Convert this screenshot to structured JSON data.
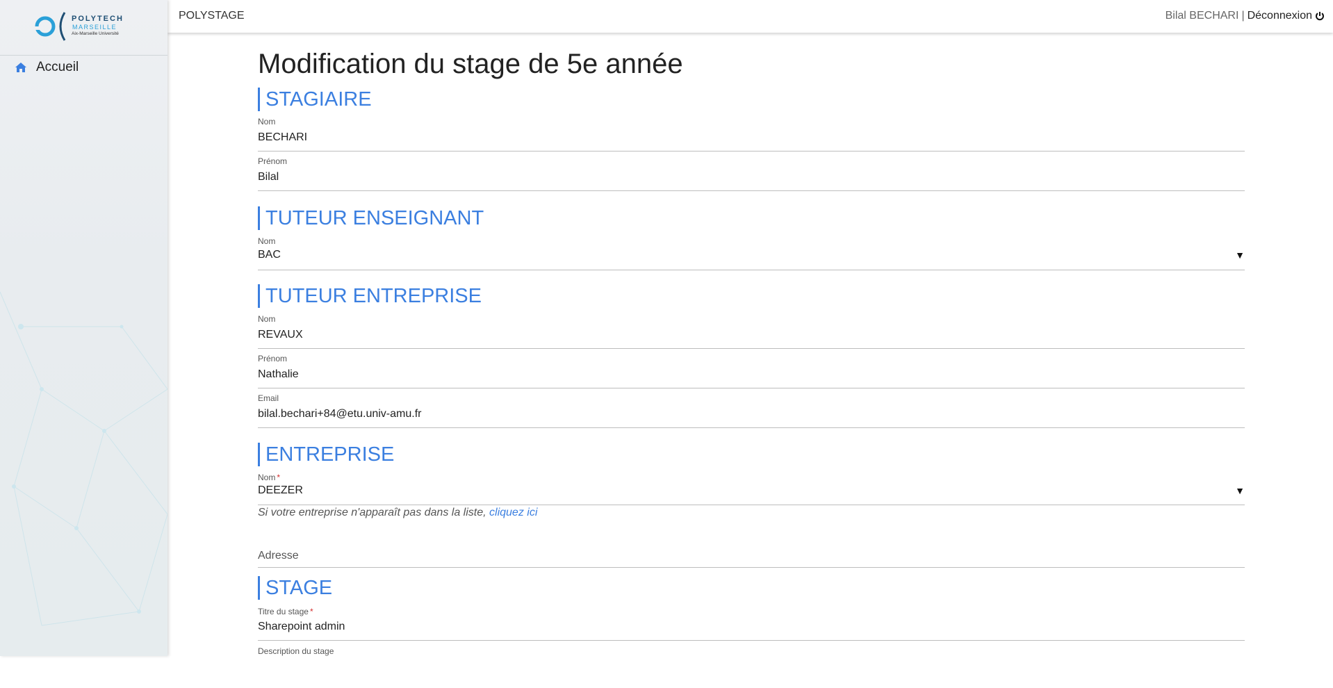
{
  "sidebar": {
    "logo": {
      "brand": "POLYTECH",
      "city": "MARSEILLE",
      "university": "Aix-Marseille Université"
    },
    "nav": [
      {
        "label": "Accueil",
        "icon": "home-icon"
      }
    ]
  },
  "header": {
    "app_title": "POLYSTAGE",
    "user_name": "Bilal BECHARI",
    "separator": "|",
    "logout_label": "Déconnexion",
    "logout_icon": "power-icon"
  },
  "page": {
    "title": "Modification du stage de 5e année",
    "accent_color": "#3b7fe0",
    "required_color": "#d32f2f"
  },
  "sections": {
    "stagiaire": {
      "heading": "STAGIAIRE",
      "nom": {
        "label": "Nom",
        "value": "BECHARI"
      },
      "prenom": {
        "label": "Prénom",
        "value": "Bilal"
      }
    },
    "tuteur_enseignant": {
      "heading": "TUTEUR ENSEIGNANT",
      "nom": {
        "label": "Nom",
        "value": "BAC"
      }
    },
    "tuteur_entreprise": {
      "heading": "TUTEUR ENTREPRISE",
      "nom": {
        "label": "Nom",
        "value": "REVAUX"
      },
      "prenom": {
        "label": "Prénom",
        "value": "Nathalie"
      },
      "email": {
        "label": "Email",
        "value": "bilal.bechari+84@etu.univ-amu.fr"
      }
    },
    "entreprise": {
      "heading": "ENTREPRISE",
      "nom": {
        "label": "Nom",
        "required_mark": "*",
        "value": "DEEZER"
      },
      "hint_text": "Si votre entreprise n'apparaît pas dans la liste, ",
      "hint_link": "cliquez ici",
      "adresse": {
        "placeholder": "Adresse"
      }
    },
    "stage": {
      "heading": "STAGE",
      "titre": {
        "label": "Titre du stage",
        "required_mark": "*",
        "value": "Sharepoint admin"
      },
      "description": {
        "label": "Description du stage"
      }
    }
  }
}
